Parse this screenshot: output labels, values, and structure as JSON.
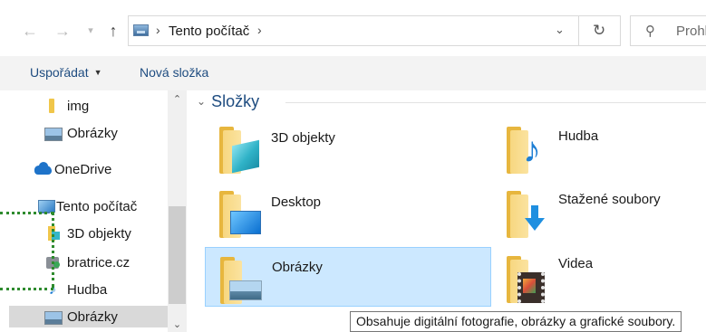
{
  "address_bar": {
    "back_icon": "arrow-left-icon",
    "forward_icon": "arrow-right-icon",
    "recent_icon": "chevron-down-icon",
    "up_icon": "arrow-up-icon",
    "breadcrumb": [
      "Tento počítač"
    ],
    "separator": "›",
    "dropdown_icon": "chevron-down-icon",
    "refresh_icon": "refresh-icon",
    "search_placeholder": "Prohl"
  },
  "commands": {
    "organize": "Uspořádat",
    "new_folder": "Nová složka"
  },
  "nav_tree": [
    {
      "label": "img",
      "icon": "folder-icon",
      "selected": false
    },
    {
      "label": "Obrázky",
      "icon": "pictures-icon",
      "selected": false
    },
    {
      "label": "OneDrive",
      "icon": "onedrive-cloud-icon",
      "selected": false
    },
    {
      "label": "Tento počítač",
      "icon": "this-pc-icon",
      "selected": false
    },
    {
      "label": "3D objekty",
      "icon": "3d-objects-icon",
      "selected": false
    },
    {
      "label": "bratrice.cz",
      "icon": "network-drive-icon",
      "selected": false
    },
    {
      "label": "Hudba",
      "icon": "music-icon",
      "selected": false
    },
    {
      "label": "Obrázky",
      "icon": "pictures-icon",
      "selected": true
    }
  ],
  "main": {
    "group_title": "Složky",
    "folders": [
      {
        "label": "3D objekty",
        "overlay": "3d-cube-icon",
        "selected": false
      },
      {
        "label": "Hudba",
        "overlay": "music-note-icon",
        "selected": false
      },
      {
        "label": "Desktop",
        "overlay": "desktop-icon",
        "selected": false
      },
      {
        "label": "Stažené soubory",
        "overlay": "download-arrow-icon",
        "selected": false
      },
      {
        "label": "Obrázky",
        "overlay": "picture-icon",
        "selected": true
      },
      {
        "label": "Videa",
        "overlay": "film-icon",
        "selected": false
      }
    ]
  },
  "tooltip": "Obsahuje digitální fotografie, obrázky a grafické soubory.",
  "colors": {
    "link_blue": "#1e4c80",
    "selection": "#cce8ff",
    "selection_border": "#99d1ff",
    "tree_selection": "#d9d9d9",
    "folder_yellow": "#f0c64a",
    "annotation_green": "#2e8b2e"
  }
}
